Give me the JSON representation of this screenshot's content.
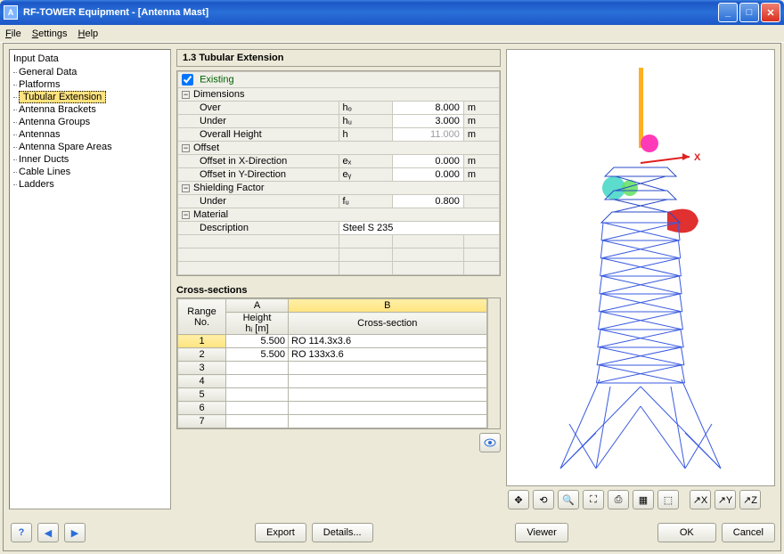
{
  "window_title": "RF-TOWER Equipment - [Antenna Mast]",
  "menu": [
    "File",
    "Settings",
    "Help"
  ],
  "tree": {
    "title": "Input Data",
    "items": [
      "General Data",
      "Platforms",
      "Tubular Extension",
      "Antenna Brackets",
      "Antenna Groups",
      "Antennas",
      "Antenna Spare Areas",
      "Inner Ducts",
      "Cable Lines",
      "Ladders"
    ],
    "selected_index": 2
  },
  "heading": "1.3 Tubular Extension",
  "existing": {
    "label": "Existing",
    "checked": true
  },
  "groups": {
    "dimensions": {
      "label": "Dimensions",
      "rows": [
        {
          "label": "Over",
          "symbol": "hₒ",
          "value": "8.000",
          "unit": "m",
          "editable": true
        },
        {
          "label": "Under",
          "symbol": "hᵤ",
          "value": "3.000",
          "unit": "m",
          "editable": true
        },
        {
          "label": "Overall Height",
          "symbol": "h",
          "value": "11.000",
          "unit": "m",
          "editable": false
        }
      ]
    },
    "offset": {
      "label": "Offset",
      "rows": [
        {
          "label": "Offset in X-Direction",
          "symbol": "eₓ",
          "value": "0.000",
          "unit": "m",
          "editable": true
        },
        {
          "label": "Offset in Y-Direction",
          "symbol": "eᵧ",
          "value": "0.000",
          "unit": "m",
          "editable": true
        }
      ]
    },
    "shielding": {
      "label": "Shielding Factor",
      "rows": [
        {
          "label": "Under",
          "symbol": "fᵤ",
          "value": "0.800",
          "unit": "",
          "editable": true
        }
      ]
    },
    "material": {
      "label": "Material",
      "rows": [
        {
          "label": "Description",
          "symbol": "",
          "value": "Steel S 235",
          "unit": "",
          "editable": true,
          "text": true
        }
      ]
    }
  },
  "cross_sections": {
    "title": "Cross-sections",
    "col_a": "A",
    "col_b": "B",
    "range_header": "Range\nNo.",
    "height_header": "Height\nhᵢ [m]",
    "cs_header": "Cross-section",
    "rows": [
      {
        "no": "1",
        "h": "5.500",
        "cs": "RO 114.3x3.6"
      },
      {
        "no": "2",
        "h": "5.500",
        "cs": "RO 133x3.6"
      },
      {
        "no": "3",
        "h": "",
        "cs": ""
      },
      {
        "no": "4",
        "h": "",
        "cs": ""
      },
      {
        "no": "5",
        "h": "",
        "cs": ""
      },
      {
        "no": "6",
        "h": "",
        "cs": ""
      },
      {
        "no": "7",
        "h": "",
        "cs": ""
      }
    ]
  },
  "buttons": {
    "export": "Export",
    "details": "Details...",
    "viewer": "Viewer",
    "ok": "OK",
    "cancel": "Cancel"
  },
  "axis_label": "X"
}
